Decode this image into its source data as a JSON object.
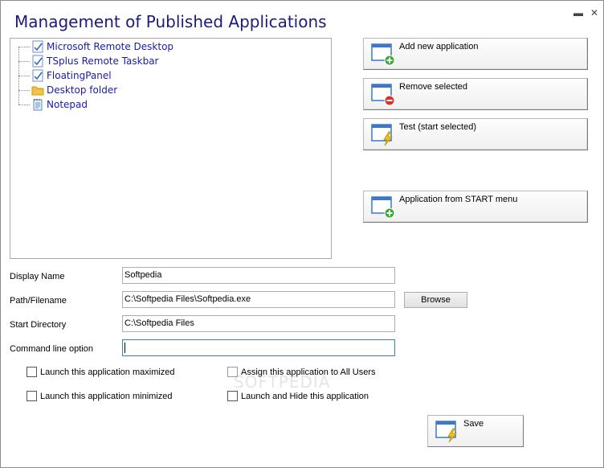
{
  "window": {
    "title": "Management of Published Applications",
    "minimize_glyph": "▬",
    "close_glyph": "✕"
  },
  "app_list": {
    "items": [
      {
        "label": "Microsoft Remote Desktop",
        "icon": "checked-document-icon"
      },
      {
        "label": "TSplus Remote Taskbar",
        "icon": "checked-document-icon"
      },
      {
        "label": "FloatingPanel",
        "icon": "checked-document-icon"
      },
      {
        "label": "Desktop folder",
        "icon": "folder-icon"
      },
      {
        "label": "Notepad",
        "icon": "notepad-icon"
      }
    ]
  },
  "actions": {
    "add_new": "Add new application",
    "remove_selected": "Remove selected",
    "test": "Test (start selected)",
    "from_start_menu": "Application from START menu"
  },
  "form": {
    "display_name": {
      "label": "Display Name",
      "value": "Softpedia"
    },
    "path": {
      "label": "Path/Filename",
      "value": "C:\\Softpedia Files\\Softpedia.exe"
    },
    "browse_label": "Browse",
    "start_dir": {
      "label": "Start Directory",
      "value": "C:\\Softpedia Files"
    },
    "cmd_option": {
      "label": "Command line option",
      "value": ""
    }
  },
  "options": {
    "maximized": "Launch this application maximized",
    "all_users": "Assign this application to All Users",
    "minimized": "Launch this application minimized",
    "hide": "Launch and Hide this application"
  },
  "save_label": "Save",
  "watermark": "SOFTPEDIA",
  "colors": {
    "title": "#1b1b7a",
    "tree_text": "#1b1ba8",
    "add_badge": "#3ba935",
    "remove_badge": "#d9342b",
    "lightning": "#f5c21b"
  }
}
